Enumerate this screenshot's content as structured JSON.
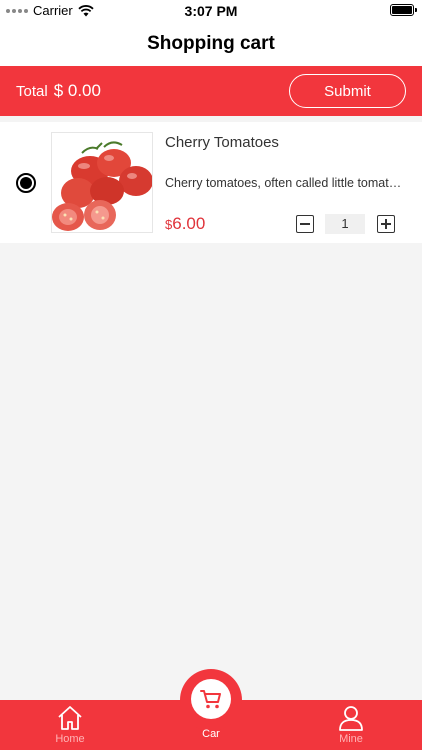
{
  "status_bar": {
    "carrier": "Carrier",
    "time": "3:07 PM"
  },
  "nav": {
    "title": "Shopping cart"
  },
  "total_bar": {
    "label": "Total",
    "value": "$ 0.00",
    "submit_label": "Submit"
  },
  "cart": {
    "items": [
      {
        "name": "Cherry Tomatoes",
        "description": "Cherry tomatoes, often called little tomatoes",
        "currency": "$",
        "price": "6.00",
        "quantity": "1",
        "selected": true
      }
    ]
  },
  "tabs": {
    "home": "Home",
    "car": "Car",
    "mine": "Mine"
  },
  "colors": {
    "accent": "#f2363d",
    "price": "#e0333a",
    "background": "#f4f4f4",
    "tab_inactive": "#ffb3b5"
  },
  "icons": {
    "home": "home-icon",
    "car": "cart-icon",
    "mine": "person-icon",
    "wifi": "wifi-icon",
    "battery": "battery-icon"
  }
}
